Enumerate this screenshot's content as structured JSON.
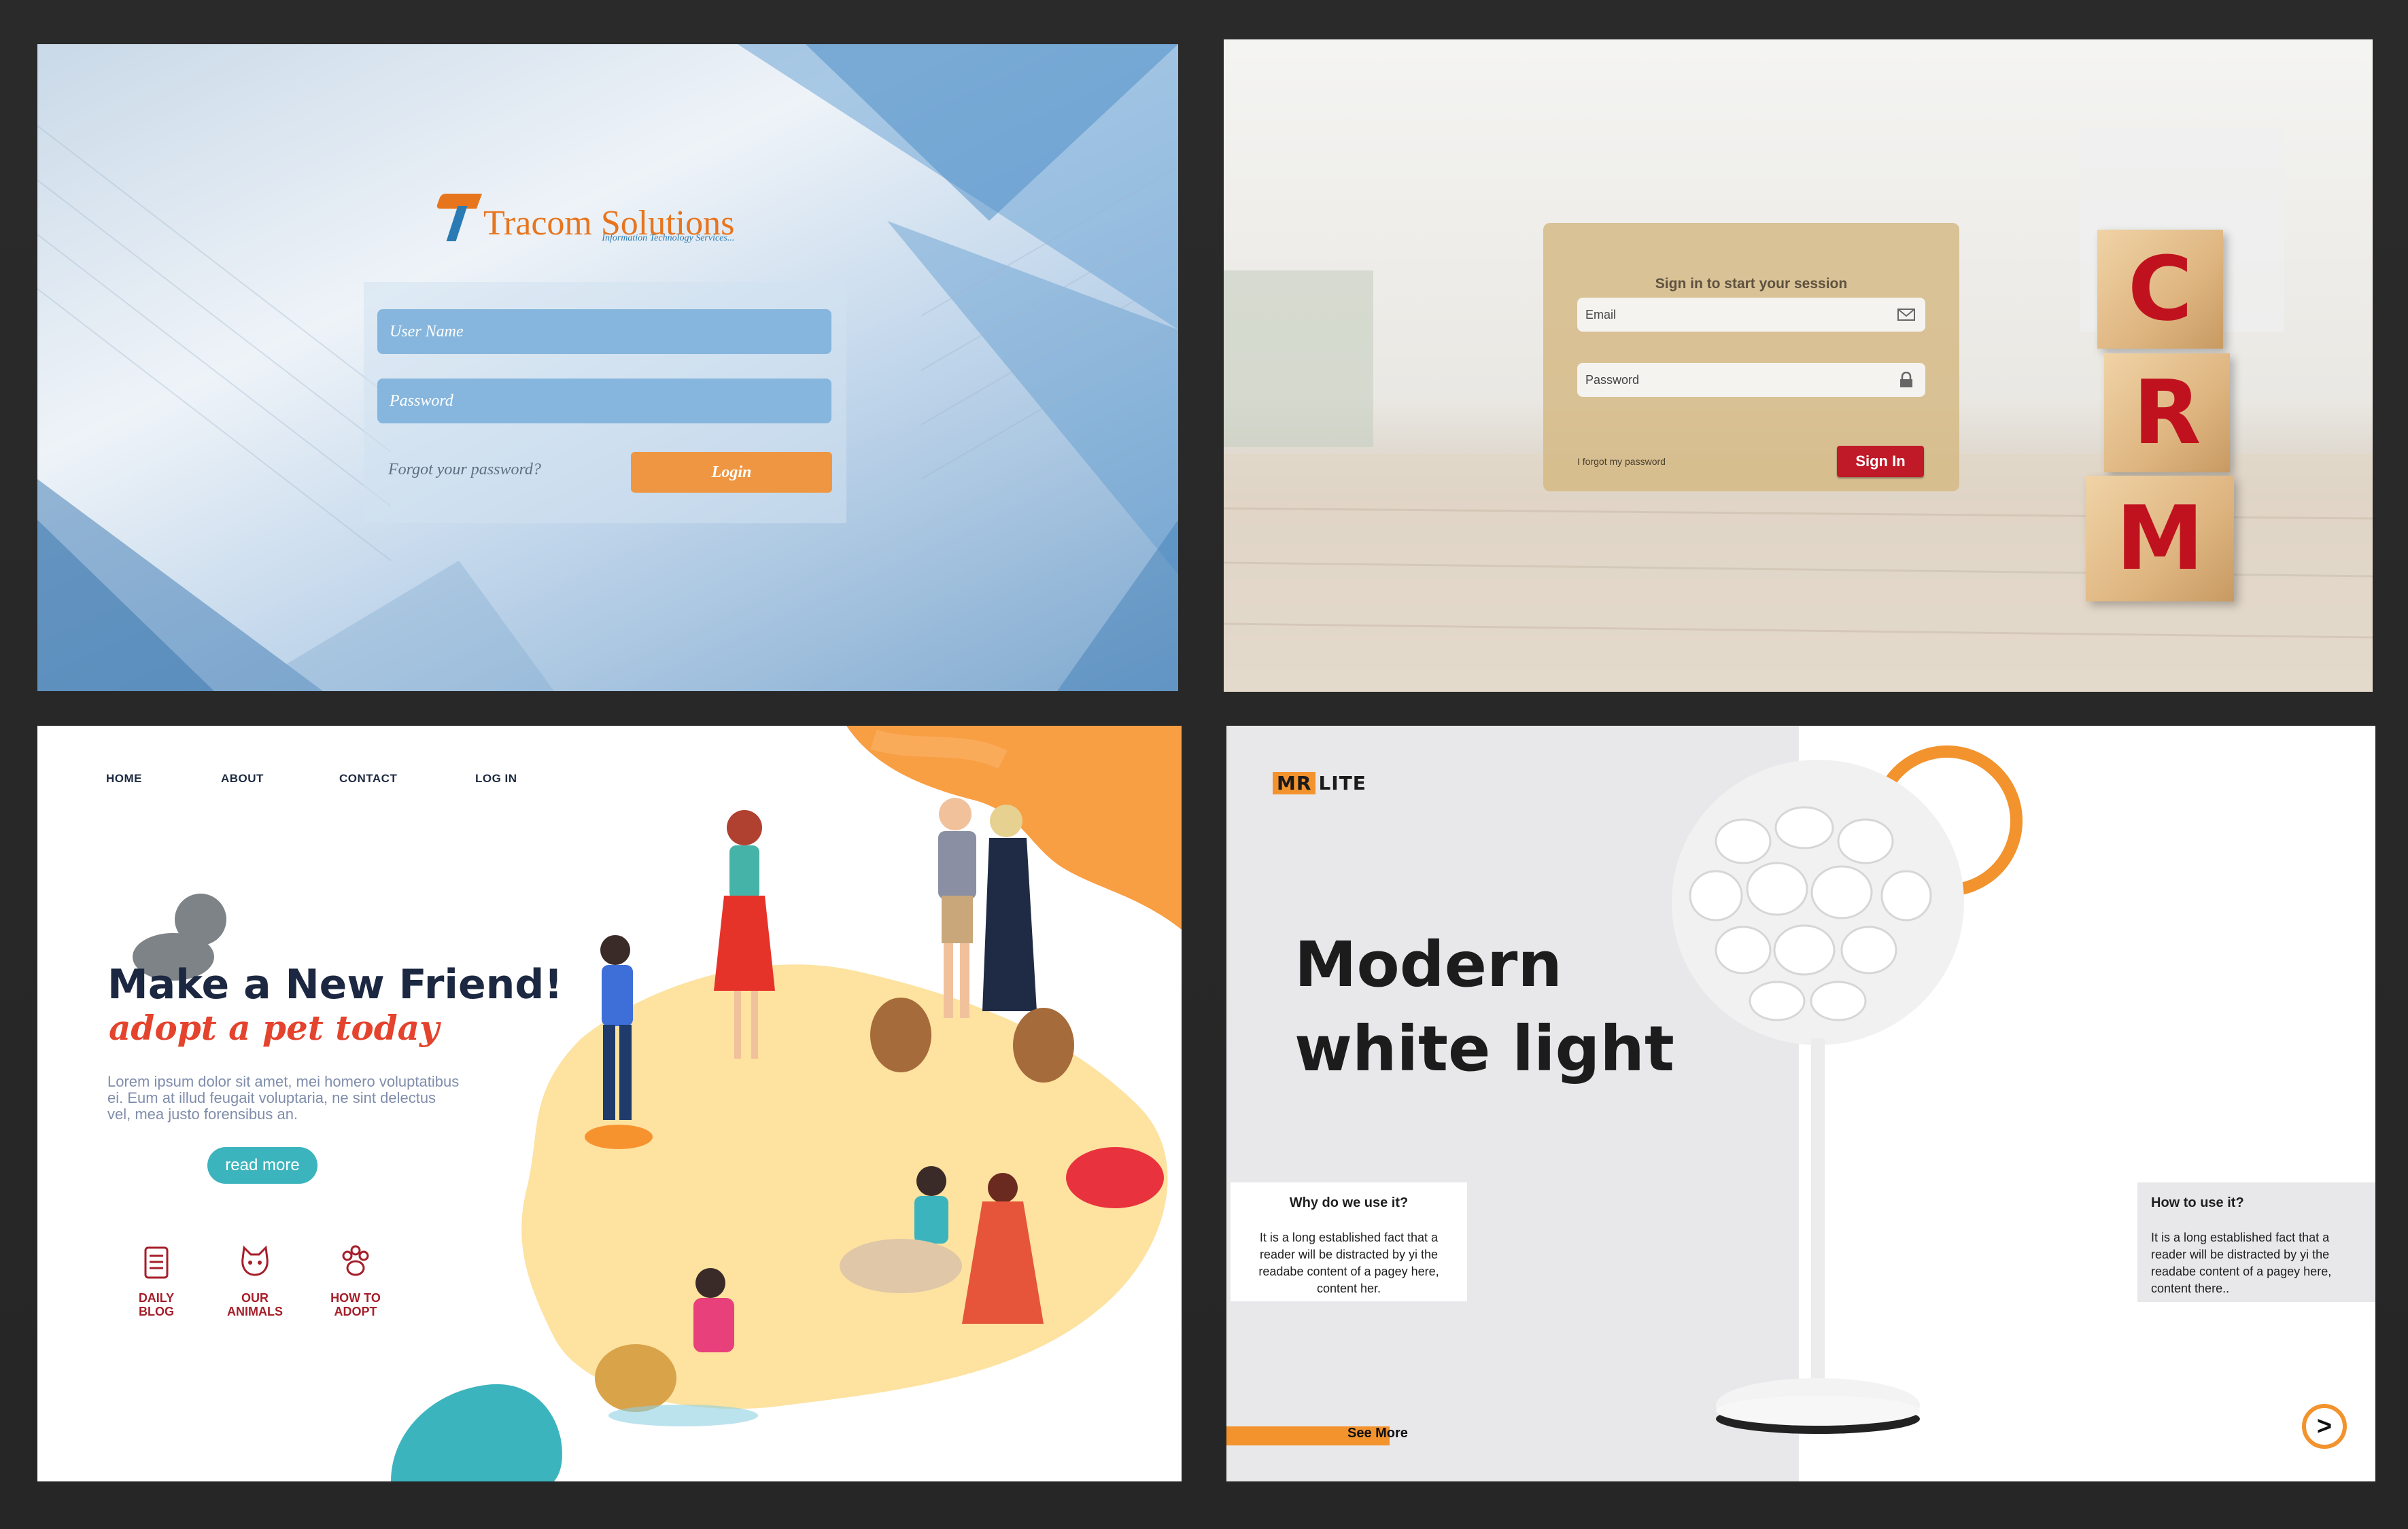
{
  "tracom": {
    "brand_name": "Tracom Solutions",
    "brand_tagline": "Information Technology Services...",
    "username_placeholder": "User Name",
    "password_placeholder": "Password",
    "forgot_link": "Forgot your password?",
    "login_button": "Login"
  },
  "crm": {
    "heading": "Sign in to start your session",
    "email_placeholder": "Email",
    "password_placeholder": "Password",
    "forgot_link": "I forgot my password",
    "signin_button": "Sign In",
    "cubes": [
      "C",
      "R",
      "M"
    ]
  },
  "pets": {
    "nav": [
      "HOME",
      "ABOUT",
      "CONTACT",
      "LOG IN"
    ],
    "headline": "Make a New Friend!",
    "subheadline": "adopt a pet today",
    "body": "Lorem ipsum dolor sit amet, mei homero voluptatibus ei. Eum at illud feugait voluptaria, ne sint delectus vel, mea justo forensibus an.",
    "cta": "read more",
    "features": [
      {
        "line1": "DAILY",
        "line2": "BLOG",
        "icon": "notepad-icon"
      },
      {
        "line1": "OUR",
        "line2": "ANIMALS",
        "icon": "cat-face-icon"
      },
      {
        "line1": "HOW TO",
        "line2": "ADOPT",
        "icon": "paw-icon"
      }
    ],
    "colors": {
      "accent_orange": "#f7932f",
      "accent_teal": "#3cb4bd",
      "headline": "#1c2841",
      "red": "#e4432d"
    }
  },
  "lite": {
    "logo_mr": "MR",
    "logo_lite": "LITE",
    "title_line1": "Modern",
    "title_line2": "white light",
    "box_left_heading": "Why do we use it?",
    "box_left_body": "It is a long established fact that a reader will be distracted by yi the readabe content of a pagey here, content her.",
    "box_right_heading": "How to  use it?",
    "box_right_body": "It is a long established fact that a reader will be distracted by yi the readabe content of a pagey here, content there..",
    "see_more": "See More",
    "next_button": ">",
    "colors": {
      "accent": "#f2932e",
      "panel_gray": "#e8e8ea"
    }
  }
}
